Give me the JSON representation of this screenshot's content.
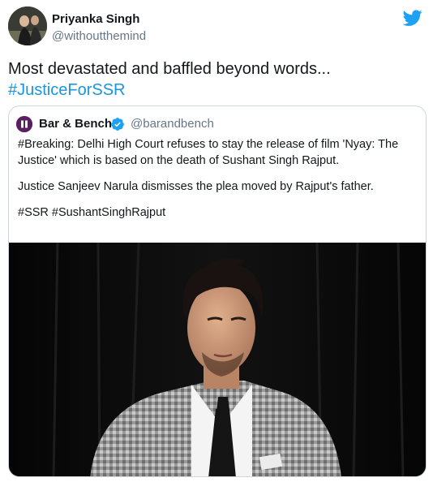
{
  "author": {
    "name": "Priyanka Singh",
    "handle": "@withoutthemind",
    "avatar_icon": "user-avatar"
  },
  "tweet": {
    "text": "Most devastated and baffled beyond words...",
    "hashtag": "#JusticeForSSR"
  },
  "quoted_tweet": {
    "name": "Bar & Bench",
    "handle": "@barandbench",
    "verified": true,
    "line1": "#Breaking: Delhi High Court refuses to stay the release of film 'Nyay: The Justice' which is based on the death of Sushant Singh Rajput.",
    "line2": "Justice Sanjeev Narula dismisses the plea moved by Rajput's father.",
    "line3": "#SSR #SushantSinghRajput"
  },
  "icons": {
    "brand": "twitter-bird-icon",
    "verified": "verified-badge-icon"
  },
  "colors": {
    "twitter_blue": "#1da1f2",
    "hashtag": "#1b95e0",
    "handle_gray": "#657786",
    "border": "#ccd6dd"
  }
}
